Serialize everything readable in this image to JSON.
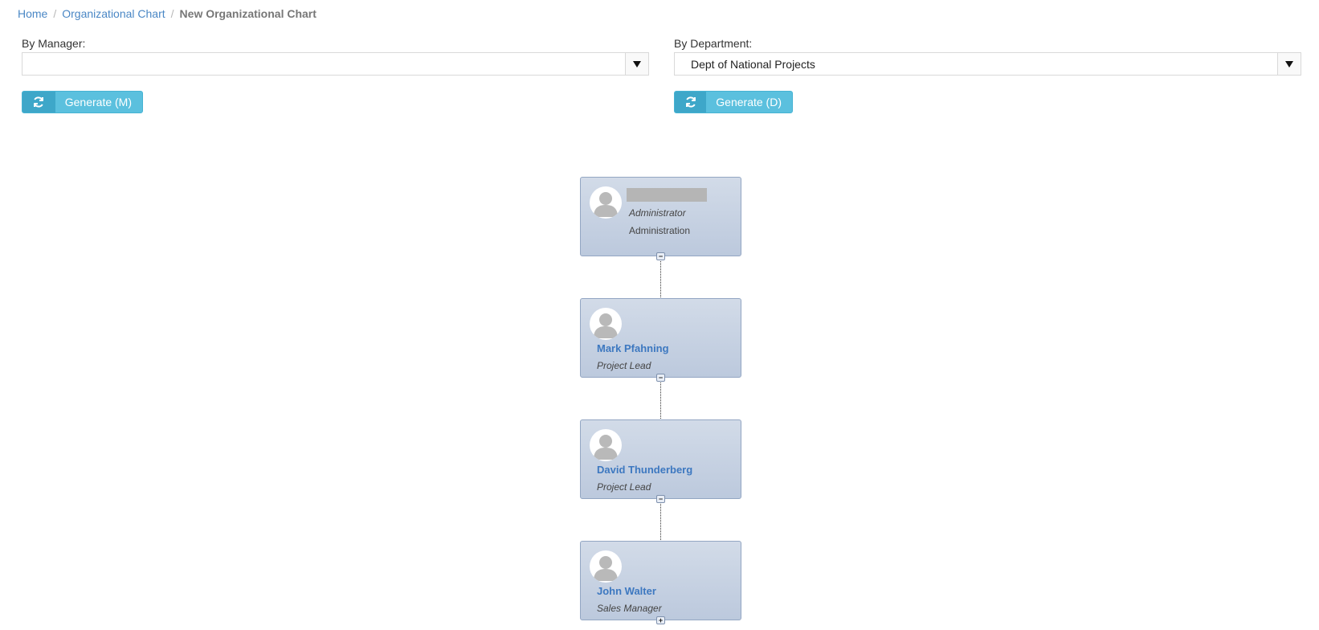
{
  "breadcrumb": {
    "home": "Home",
    "org_chart": "Organizational Chart",
    "current": "New Organizational Chart",
    "separator": "/"
  },
  "by_manager": {
    "label": "By Manager:",
    "selected": "",
    "button_label": "Generate (M)"
  },
  "by_department": {
    "label": "By Department:",
    "selected": "Dept of National Projects",
    "button_label": "Generate (D)"
  },
  "org_nodes": [
    {
      "name": "",
      "title": "Administrator",
      "department": "Administration",
      "toggle": "−"
    },
    {
      "name": "Mark Pfahning",
      "title": "Project Lead",
      "toggle": "−"
    },
    {
      "name": "David Thunderberg",
      "title": "Project Lead",
      "toggle": "−"
    },
    {
      "name": "John Walter",
      "title": "Sales Manager",
      "toggle": "+"
    }
  ],
  "icons": {
    "dropdown": "chevron-down-icon",
    "generate": "refresh-icon",
    "avatar": "user-avatar-icon"
  },
  "colors": {
    "link": "#4a87c5",
    "button": "#5bc0de",
    "button_icon_bg": "#3ea7c9",
    "node_bg": "#c8d3e4",
    "node_name": "#3d78c0"
  }
}
